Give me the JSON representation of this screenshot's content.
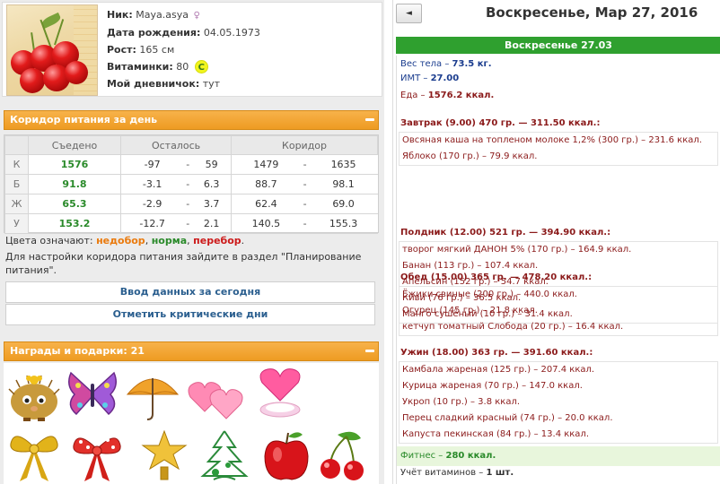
{
  "profile": {
    "nick_label": "Ник:",
    "nick": "Maya.asya",
    "birth_label": "Дата рождения:",
    "birth": "04.05.1973",
    "height_label": "Рост:",
    "height": "165 см",
    "vitamins_label": "Витаминки:",
    "vitamins": "80",
    "vitamins_badge": "C",
    "diary_label": "Мой дневничок:",
    "diary": "тут"
  },
  "corridor": {
    "title": "Коридор питания за день",
    "headers": [
      "Съедено",
      "Осталось",
      "Коридор"
    ],
    "rows": [
      {
        "label": "К",
        "eaten": "1576",
        "left_min": "-97",
        "left_max": "59",
        "corr_min": "1479",
        "corr_max": "1635"
      },
      {
        "label": "Б",
        "eaten": "91.8",
        "left_min": "-3.1",
        "left_max": "6.3",
        "corr_min": "88.7",
        "corr_max": "98.1"
      },
      {
        "label": "Ж",
        "eaten": "65.3",
        "left_min": "-2.9",
        "left_max": "3.7",
        "corr_min": "62.4",
        "corr_max": "69.0"
      },
      {
        "label": "У",
        "eaten": "153.2",
        "left_min": "-12.7",
        "left_max": "2.1",
        "corr_min": "140.5",
        "corr_max": "155.3"
      }
    ],
    "dash": "-",
    "legend_prefix": "Цвета означают:",
    "legend_under": "недобор",
    "legend_norm": "норма",
    "legend_over": "перебор",
    "hint": "Для настройки коридора питания зайдите в раздел \"Планирование питания\".",
    "btn_enter": "Ввод данных за сегодня",
    "btn_critical": "Отметить критические дни"
  },
  "awards": {
    "title": "Награды и подарки: 21",
    "items": [
      "hedgehog-icon",
      "butterfly-icon",
      "umbrella-icon",
      "hearts-icon",
      "heart-box-icon",
      "gold-bow-icon",
      "red-bow-icon",
      "star-icon",
      "tree-icon",
      "apple-icon",
      "cherries-icon"
    ]
  },
  "day": {
    "back_label": "◄",
    "title": "Воскресенье, Мар 27, 2016",
    "bar": "Воскресенье 27.03",
    "weight_label": "Вес тела",
    "weight": "73.5 кг.",
    "bmi_label": "ИМТ",
    "bmi": "27.00",
    "food_label": "Еда",
    "food": "1576.2 ккал.",
    "meals": [
      {
        "title": "Завтрак (9.00) 470 гр. — 311.50 ккал.:",
        "items": [
          "Овсяная каша на топленом молоке 1,2% (300 гр.) – 231.6 ккал.",
          "Яблоко (170 гр.) – 79.9 ккал."
        ]
      },
      {
        "title": "Полдник (12.00) 521 гр. — 394.90 ккал.:",
        "items": [
          "творог мягкий ДАНОН 5% (170 гр.) – 164.9 ккал.",
          "Банан (113 гр.) – 107.4 ккал.",
          "Апельсин (152 гр.) – 54.7 ккал.",
          "Киви (76 гр.) – 36.5 ккал.",
          "Манго сушёный (10 гр.) – 31.4 ккал."
        ]
      },
      {
        "title": "Обед (15.00) 365 гр. — 478.20 ккал.:",
        "items": [
          "Ёжики свиные (200 гр.) – 440.0 ккал.",
          "Огурец (145 гр.) – 21.8 ккал.",
          "кетчуп томатный Слобода (20 гр.) – 16.4 ккал."
        ]
      },
      {
        "title": "Ужин (18.00) 363 гр. — 391.60 ккал.:",
        "items": [
          "Камбала жареная (125 гр.) – 207.4 ккал.",
          "Курица жареная (70 гр.) – 147.0 ккал.",
          "Укроп (10 гр.) – 3.8 ккал.",
          "Перец сладкий красный (74 гр.) – 20.0 ккал.",
          "Капуста пекинская (84 гр.) – 13.4 ккал."
        ]
      }
    ],
    "fitness_label": "Фитнес",
    "fitness": "280 ккал.",
    "vitamins_label": "Учёт витаминов",
    "vitamins": "1 шт."
  },
  "colors": {
    "accent_orange": "#ee9b22",
    "green_bar": "#2fa02f",
    "dark_red": "#8b1a1a",
    "blue": "#1a3c8e"
  }
}
